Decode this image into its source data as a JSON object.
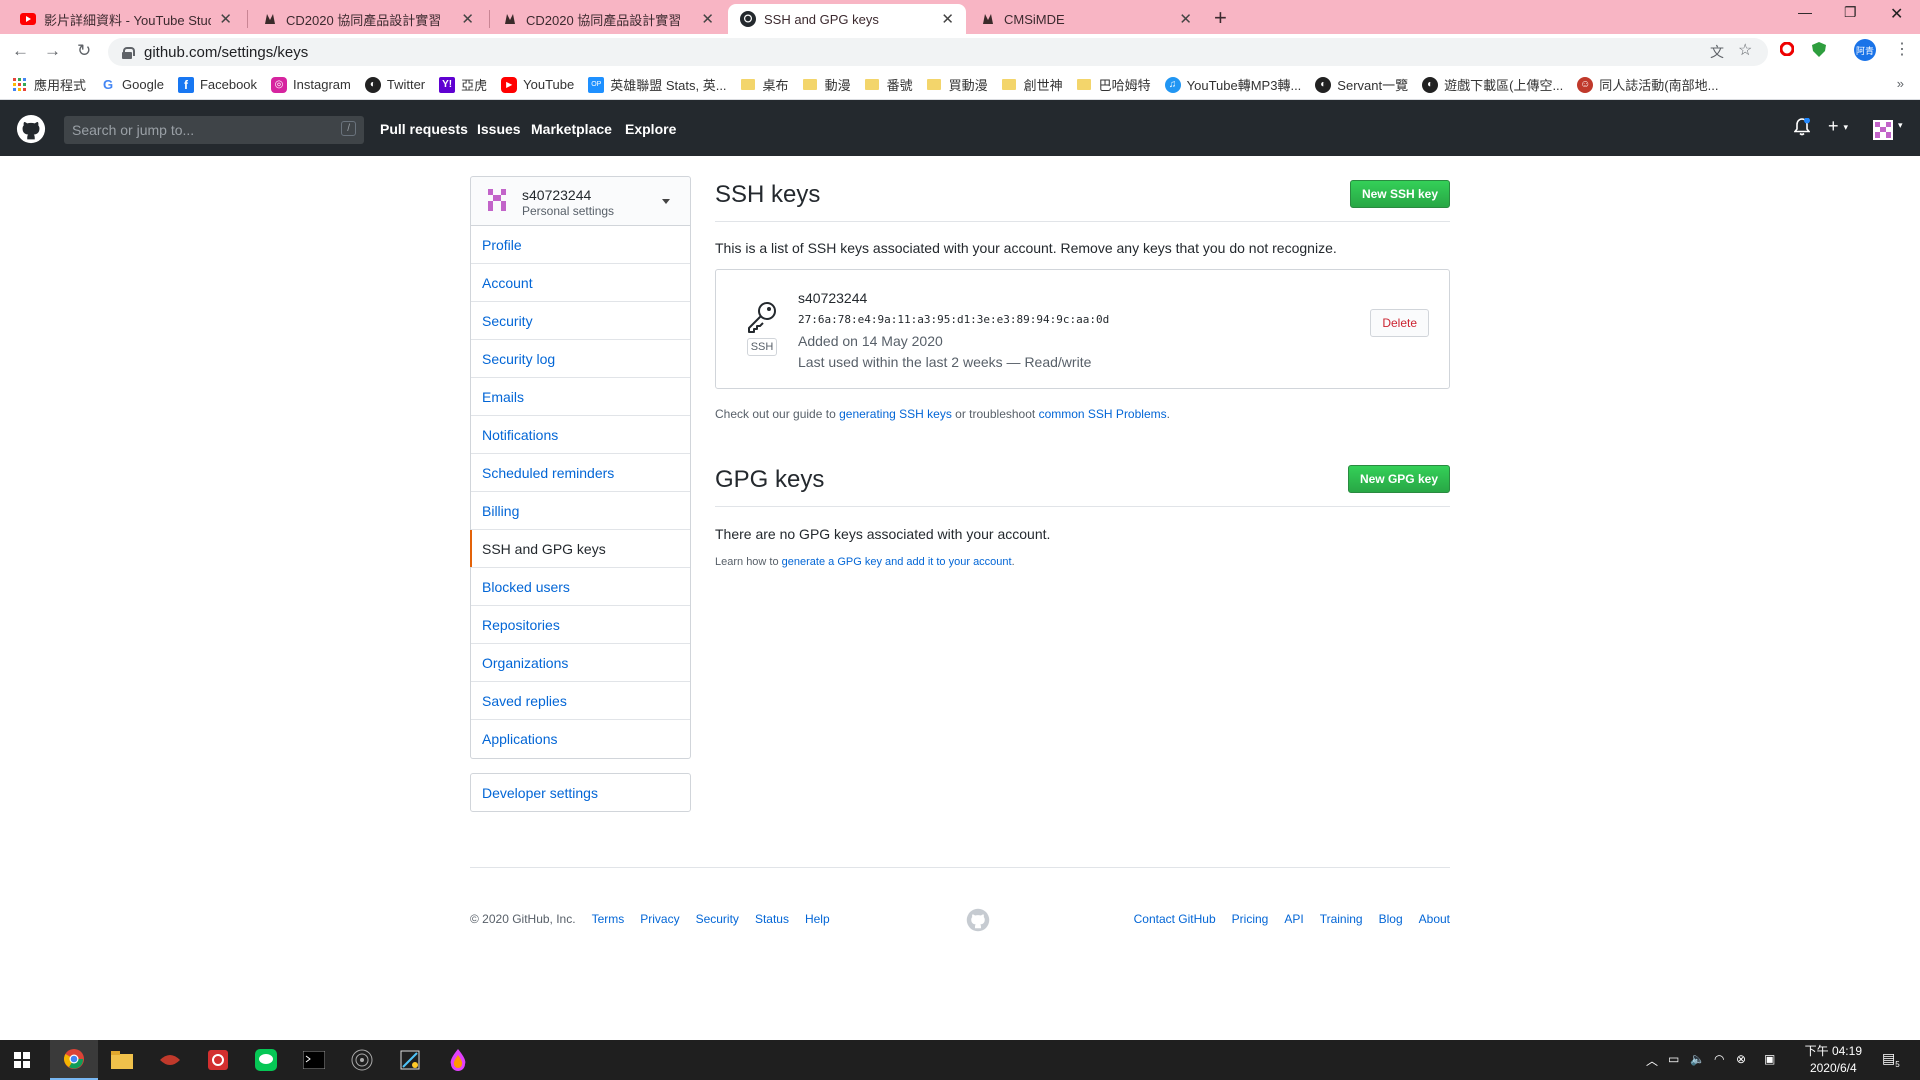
{
  "browser": {
    "tabs": [
      {
        "title": "影片詳細資料 - YouTube Studio",
        "active": false
      },
      {
        "title": "CD2020 協同產品設計實習",
        "active": false
      },
      {
        "title": "CD2020 協同產品設計實習",
        "active": false
      },
      {
        "title": "SSH and GPG keys",
        "active": true
      },
      {
        "title": "CMSiMDE",
        "active": false
      }
    ],
    "url": "github.com/settings/keys",
    "profile_label": "阿青",
    "bookmarks": [
      {
        "label": "應用程式",
        "icon": "apps-grid-icon"
      },
      {
        "label": "Google",
        "icon": "google-icon"
      },
      {
        "label": "Facebook",
        "icon": "facebook-icon"
      },
      {
        "label": "Instagram",
        "icon": "instagram-icon"
      },
      {
        "label": "Twitter",
        "icon": "globe-icon"
      },
      {
        "label": "亞虎",
        "icon": "yahoo-icon"
      },
      {
        "label": "YouTube",
        "icon": "youtube-icon"
      },
      {
        "label": "英雄聯盟 Stats, 英...",
        "icon": "opgg-icon"
      },
      {
        "label": "桌布",
        "icon": "folder-icon"
      },
      {
        "label": "動漫",
        "icon": "folder-icon"
      },
      {
        "label": "番號",
        "icon": "folder-icon"
      },
      {
        "label": "買動漫",
        "icon": "folder-icon"
      },
      {
        "label": "創世神",
        "icon": "folder-icon"
      },
      {
        "label": "巴哈姆特",
        "icon": "folder-icon"
      },
      {
        "label": "YouTube轉MP3轉...",
        "icon": "converter-icon"
      },
      {
        "label": "Servant一覽",
        "icon": "globe-icon"
      },
      {
        "label": "遊戲下載區(上傳空...",
        "icon": "globe-icon"
      },
      {
        "label": "同人誌活動(南部地...",
        "icon": "character-icon"
      }
    ]
  },
  "github": {
    "search_placeholder": "Search or jump to...",
    "search_shortcut": "/",
    "nav": [
      "Pull requests",
      "Issues",
      "Marketplace",
      "Explore"
    ]
  },
  "sidebar": {
    "username": "s40723244",
    "subtitle": "Personal settings",
    "items": [
      {
        "label": "Profile",
        "selected": false
      },
      {
        "label": "Account",
        "selected": false
      },
      {
        "label": "Security",
        "selected": false
      },
      {
        "label": "Security log",
        "selected": false
      },
      {
        "label": "Emails",
        "selected": false
      },
      {
        "label": "Notifications",
        "selected": false
      },
      {
        "label": "Scheduled reminders",
        "selected": false
      },
      {
        "label": "Billing",
        "selected": false
      },
      {
        "label": "SSH and GPG keys",
        "selected": true
      },
      {
        "label": "Blocked users",
        "selected": false
      },
      {
        "label": "Repositories",
        "selected": false
      },
      {
        "label": "Organizations",
        "selected": false
      },
      {
        "label": "Saved replies",
        "selected": false
      },
      {
        "label": "Applications",
        "selected": false
      }
    ],
    "developer_settings": "Developer settings"
  },
  "ssh": {
    "title": "SSH keys",
    "new_button": "New SSH key",
    "description": "This is a list of SSH keys associated with your account. Remove any keys that you do not recognize.",
    "key": {
      "tag": "SSH",
      "name": "s40723244",
      "fingerprint": "27:6a:78:e4:9a:11:a3:95:d1:3e:e3:89:94:9c:aa:0d",
      "added": "Added on 14 May 2020",
      "last_used": "Last used within the last 2 weeks — Read/write",
      "delete_button": "Delete"
    },
    "guide_prefix": "Check out our guide to",
    "guide_link": "generating SSH keys",
    "guide_middle": "or troubleshoot",
    "guide_link2": "common SSH Problems",
    "guide_suffix": "."
  },
  "gpg": {
    "title": "GPG keys",
    "new_button": "New GPG key",
    "empty_text": "There are no GPG keys associated with your account.",
    "learn_prefix": "Learn how to",
    "learn_link": "generate a GPG key and add it to your account",
    "learn_suffix": "."
  },
  "footer": {
    "copyright": "© 2020 GitHub, Inc.",
    "left_links": [
      "Terms",
      "Privacy",
      "Security",
      "Status",
      "Help"
    ],
    "right_links": [
      "Contact GitHub",
      "Pricing",
      "API",
      "Training",
      "Blog",
      "About"
    ]
  },
  "taskbar": {
    "time": "下午 04:19",
    "date": "2020/6/4",
    "notification_count": "5"
  },
  "colors": {
    "tab_strip": "#f8b5c4",
    "github_header": "#24292e",
    "link": "#0366d6",
    "green_button": "#2ea44f",
    "selected_marker": "#e36209",
    "delete": "#cb2431"
  }
}
